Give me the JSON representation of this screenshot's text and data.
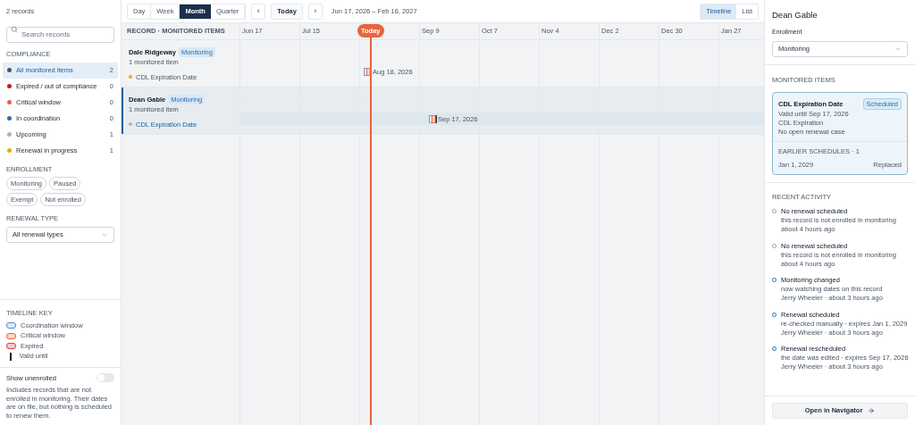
{
  "sidebar": {
    "record_count": "2 records",
    "search": {
      "placeholder": "Search records"
    },
    "compliance": {
      "title": "COMPLIANCE",
      "items": [
        {
          "label": "All monitored items",
          "count": "2",
          "color": "#4b5563",
          "selected": true
        },
        {
          "label": "Expired / out of compliance",
          "count": "0",
          "color": "#c81e1e",
          "selected": false
        },
        {
          "label": "Critical window",
          "count": "0",
          "color": "#e8643a",
          "selected": false
        },
        {
          "label": "In coordination",
          "count": "0",
          "color": "#2a6fb0",
          "selected": false
        },
        {
          "label": "Upcoming",
          "count": "1",
          "color": "#b0b4ba",
          "selected": false
        },
        {
          "label": "Renewal in progress",
          "count": "1",
          "color": "#f0a81c",
          "selected": false
        }
      ]
    },
    "enrollment": {
      "title": "ENROLLMENT",
      "chips": [
        "Monitoring",
        "Paused",
        "Exempt",
        "Not enrolled"
      ]
    },
    "renewal_type": {
      "title": "RENEWAL TYPE",
      "value": "All renewal types"
    },
    "timeline_key": {
      "title": "TIMELINE KEY",
      "items": [
        {
          "kind": "coordination",
          "label": "Coordination window"
        },
        {
          "kind": "critical",
          "label": "Critical window"
        },
        {
          "kind": "expired",
          "label": "Expired"
        },
        {
          "kind": "valid",
          "label": "Valid until"
        }
      ]
    },
    "show_unenrolled": {
      "label": "Show unenrolled",
      "on": false,
      "description": "Includes records that are not enrolled in monitoring. Their dates are on file, but nothing is scheduled to renew them."
    }
  },
  "toolbar": {
    "ranges": [
      {
        "label": "Day",
        "selected": false
      },
      {
        "label": "Week",
        "selected": false
      },
      {
        "label": "Month",
        "selected": true
      },
      {
        "label": "Quarter",
        "selected": false
      }
    ],
    "today": "Today",
    "prev": "‹",
    "next": "›",
    "range_label": "Jun 17, 2026 – Feb 16, 2027",
    "views": [
      {
        "label": "Timeline",
        "selected": true
      },
      {
        "label": "List",
        "selected": false
      }
    ]
  },
  "timeline": {
    "header": "RECORD · MONITORED ITEMS",
    "columns": [
      {
        "label": "Jun 17"
      },
      {
        "label": "Jul 15"
      },
      {
        "kind": "today",
        "label": "Today"
      },
      {
        "label": "Sep 9"
      },
      {
        "label": "Oct 7"
      },
      {
        "label": "Nov 4"
      },
      {
        "label": "Dec 2"
      },
      {
        "label": "Dec 30"
      },
      {
        "label": "Jan 27"
      }
    ],
    "rows": [
      {
        "name": "Dale Ridgeway",
        "badge": "Monitoring",
        "subtitle": "1 monitored item",
        "selected": false,
        "items": [
          {
            "label": "CDL Expiration Date",
            "color": "#f0a81c",
            "date": "Aug 18, 2026"
          }
        ]
      },
      {
        "name": "Dean Gable",
        "badge": "Monitoring",
        "subtitle": "1 monitored item",
        "selected": true,
        "items": [
          {
            "label": "CDL Expiration Date",
            "color": "#b0b4ba",
            "date": "Sep 17, 2026"
          }
        ]
      }
    ]
  },
  "detail": {
    "title": "Dean Gable",
    "enrollment_label": "Enrollment",
    "enrollment_value": "Monitoring",
    "monitored_title": "MONITORED ITEMS",
    "card": {
      "title": "CDL Expiration Date",
      "status": "Scheduled",
      "lines": [
        "Valid until Sep 17, 2026",
        "CDL Expiration",
        "No open renewal case"
      ],
      "earlier_title": "EARLIER SCHEDULES · 1",
      "earlier": [
        {
          "date": "Jan 1, 2029",
          "status": "Replaced"
        }
      ]
    },
    "activity_title": "RECENT ACTIVITY",
    "activity": [
      {
        "kind": "system",
        "title": "No renewal scheduled",
        "detail": "this record is not enrolled in monitoring",
        "meta": "about 4 hours ago"
      },
      {
        "kind": "system",
        "title": "No renewal scheduled",
        "detail": "this record is not enrolled in monitoring",
        "meta": "about 4 hours ago"
      },
      {
        "kind": "user",
        "title": "Monitoring changed",
        "detail": "now watching dates on this record",
        "meta": "Jerry Wheeler · about 3 hours ago"
      },
      {
        "kind": "user",
        "title": "Renewal scheduled",
        "detail": "re-checked manually · expires Jan 1, 2029",
        "meta": "Jerry Wheeler · about 3 hours ago"
      },
      {
        "kind": "user",
        "title": "Renewal rescheduled",
        "detail": "the date was edited · expires Sep 17, 2026",
        "meta": "Jerry Wheeler · about 3 hours ago"
      }
    ],
    "open_button": "Open in Navigator"
  }
}
